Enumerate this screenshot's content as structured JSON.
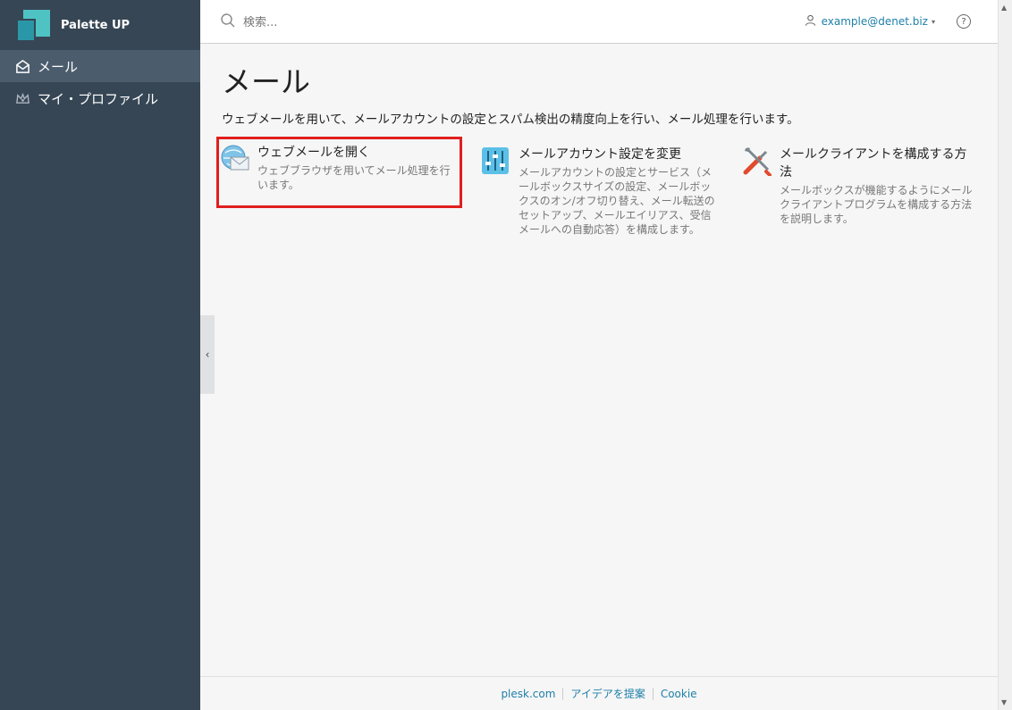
{
  "brand": {
    "name": "Palette UP"
  },
  "sidebar": {
    "items": [
      {
        "label": "メール",
        "icon": "mail-open-icon",
        "active": true
      },
      {
        "label": "マイ・プロファイル",
        "icon": "crown-icon",
        "active": false
      }
    ]
  },
  "header": {
    "search_placeholder": "検索...",
    "user_email": "example@denet.biz",
    "help_label": "?"
  },
  "main": {
    "title": "メール",
    "description": "ウェブメールを用いて、メールアカウントの設定とスパム検出の精度向上を行い、メール処理を行います。",
    "cards": [
      {
        "title": "ウェブメールを開く",
        "text": "ウェブブラウザを用いてメール処理を行います。",
        "icon": "webmail-icon"
      },
      {
        "title": "メールアカウント設定を変更",
        "text": "メールアカウントの設定とサービス（メールボックスサイズの設定、メールボックスのオン/オフ切り替え、メール転送のセットアップ、メールエイリアス、受信メールへの自動応答）を構成します。",
        "icon": "settings-sliders-icon"
      },
      {
        "title": "メールクライアントを構成する方法",
        "text": "メールボックスが機能するようにメールクライアントプログラムを構成する方法を説明します。",
        "icon": "tools-icon"
      }
    ]
  },
  "footer": {
    "links": [
      "plesk.com",
      "アイデアを提案",
      "Cookie"
    ]
  },
  "colors": {
    "sidebar_bg": "#364655",
    "accent": "#1e7fa8",
    "highlight_border": "#e01e1e"
  }
}
